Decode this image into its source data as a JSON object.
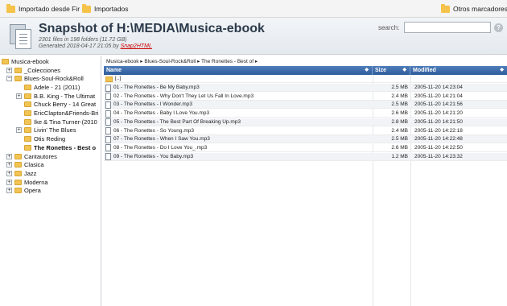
{
  "bookmarks": {
    "items": [
      "Importado desde Fir",
      "Importados"
    ],
    "other": "Otros marcadores"
  },
  "header": {
    "title": "Snapshot of H:\\MEDIA\\Musica-ebook",
    "stats": "2301 files in 198 folders (11.72 GB)",
    "generated_prefix": "Generated 2018-04-17 21:05 by ",
    "generator": "Snap2HTML",
    "search_label": "search:",
    "search_value": "",
    "help": "?"
  },
  "tree": {
    "root": "Musica-ebook",
    "items": [
      {
        "label": "_Colecciones",
        "depth": 1,
        "expander": "+"
      },
      {
        "label": "Blues-Soul-Rock&Roll",
        "depth": 1,
        "expander": "−"
      },
      {
        "label": "Adele - 21 (2011)",
        "depth": 2,
        "expander": ""
      },
      {
        "label": "B.B. King - The Ultimat",
        "depth": 2,
        "expander": "+"
      },
      {
        "label": "Chuck Berry - 14 Great",
        "depth": 2,
        "expander": ""
      },
      {
        "label": "EricClapton&Friends-Bri",
        "depth": 2,
        "expander": ""
      },
      {
        "label": "Ike & Tina Turner-(2010",
        "depth": 2,
        "expander": ""
      },
      {
        "label": "Livin' The Blues",
        "depth": 2,
        "expander": "+"
      },
      {
        "label": "Otis Reding",
        "depth": 2,
        "expander": ""
      },
      {
        "label": "The Ronettes - Best o",
        "depth": 2,
        "expander": "",
        "selected": true
      },
      {
        "label": "Cantautores",
        "depth": 1,
        "expander": "+"
      },
      {
        "label": "Clasica",
        "depth": 1,
        "expander": "+"
      },
      {
        "label": "Jazz",
        "depth": 1,
        "expander": "+"
      },
      {
        "label": "Moderna",
        "depth": 1,
        "expander": "+"
      },
      {
        "label": "Opera",
        "depth": 1,
        "expander": "+"
      }
    ]
  },
  "main": {
    "breadcrumb": "Musica-ebook ▸ Blues-Soul-Rock&Roll ▸ The Ronettes - Best of ▸",
    "columns": {
      "name": "Name",
      "size": "Size",
      "modified": "Modified"
    },
    "sort_glyph": "◆",
    "parent_label": "[..]",
    "files": [
      {
        "name": "01 - The Ronettes - Be My Baby.mp3",
        "size": "2.5 MB",
        "modified": "2005-11-20 14:23:04"
      },
      {
        "name": "02 - The Ronettes - Why Don't They Let Us Fall In Love.mp3",
        "size": "2.4 MB",
        "modified": "2005-11-20 14:21:04"
      },
      {
        "name": "03 - The Ronettes - I Wonder.mp3",
        "size": "2.5 MB",
        "modified": "2005-11-20 14:21:56"
      },
      {
        "name": "04 - The Ronettes - Baby I Love You.mp3",
        "size": "2.6 MB",
        "modified": "2005-11-20 14:21:20"
      },
      {
        "name": "05 - The Ronettes - The Best Part Of Breaking Up.mp3",
        "size": "2.8 MB",
        "modified": "2005-11-20 14:21:50"
      },
      {
        "name": "06 - The Ronettes - So Young.mp3",
        "size": "2.4 MB",
        "modified": "2005-11-20 14:22:18"
      },
      {
        "name": "07 - The Ronettes - When I Saw You.mp3",
        "size": "2.5 MB",
        "modified": "2005-11-20 14:22:48"
      },
      {
        "name": "08 - The Ronettes - Do I Love You_.mp3",
        "size": "2.6 MB",
        "modified": "2005-11-20 14:22:50"
      },
      {
        "name": "09 - The Ronettes - You Baby.mp3",
        "size": "1.2 MB",
        "modified": "2005-11-20 14:23:32"
      }
    ]
  },
  "colors": {
    "header_blue": "#2f5c9c",
    "folder_yellow": "#f1c454",
    "link_red": "#cc0000"
  }
}
